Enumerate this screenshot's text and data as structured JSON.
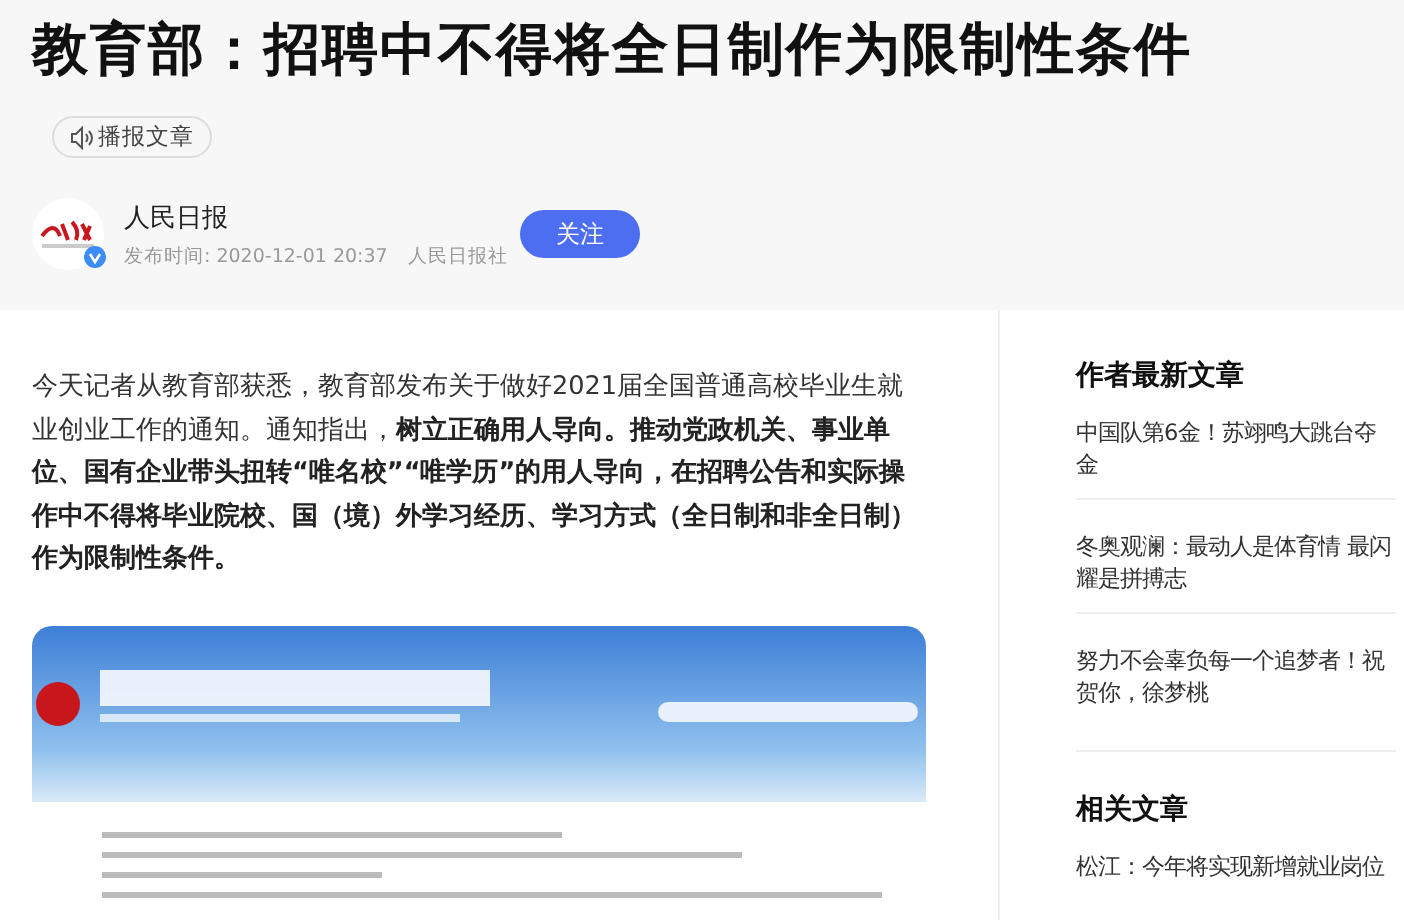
{
  "article": {
    "title": "教育部：招聘中不得将全日制作为限制性条件",
    "listen_button": "播报文章",
    "author": {
      "name": "人民日报",
      "verified": true,
      "publish_time": "发布时间: 2020-12-01 20:37",
      "source": "人民日报社",
      "follow_button": "关注"
    },
    "lead": "今天记者从教育部获悉，教育部发布关于做好2021届全国普通高校毕业生就业创业工作的通知。通知指出，**树立正确用人导向。推动党政机关、事业单位、国有企业带头扭转“唯名校”“唯学历”的用人导向，在招聘公告和实际操作中不得将毕业院校、国（境）外学习经历、学习方式（全日制和非全日制）作为限制性条件。**"
  },
  "sidebar": {
    "sections": [
      {
        "heading": "作者最新文章",
        "items": [
          "中国队第6金！苏翊鸣大跳台夺金",
          "冬奥观澜：最动人是体育情 最闪耀是拼搏志",
          "努力不会辜负每一个追梦者！祝贺你，徐梦桃"
        ]
      },
      {
        "heading": "相关文章",
        "items": [
          "松江：今年将实现新增就业岗位"
        ]
      }
    ]
  }
}
